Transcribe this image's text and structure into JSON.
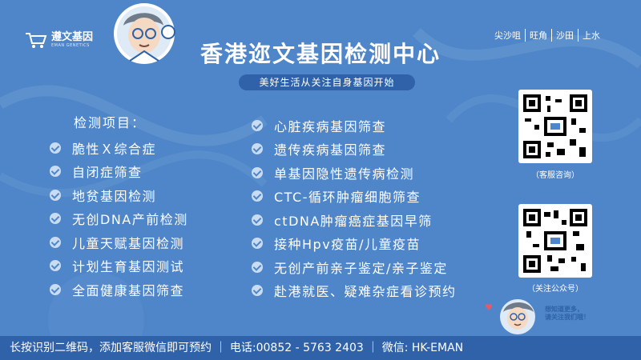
{
  "logo": {
    "name": "遵文基因",
    "sub": "EMAN GENETICS"
  },
  "title": "香港迩文基因检测中心",
  "subtitle": "美好生活从关注自身基因开始",
  "areas": [
    "尖沙咀",
    "旺角",
    "沙田",
    "上水"
  ],
  "left_column": {
    "header": "检测项目：",
    "items": [
      "脆性Ｘ综合症",
      "自闭症筛查",
      "地贫基因检测",
      "无创DNA产前检测",
      "儿童天赋基因检测",
      "计划生育基因测试",
      "全面健康基因筛查"
    ]
  },
  "right_column": {
    "items": [
      "心脏疾病基因筛查",
      "遗传疾病基因筛查",
      "单基因隐性遗传病检测",
      "CTC-循环肿瘤细胞筛查",
      "ctDNA肿瘤癌症基因早筛",
      "接种Hpv疫苗/儿童疫苗",
      "无创产前亲子鉴定/亲子鉴定",
      "赴港就医、疑难杂症看诊预约"
    ]
  },
  "qr": {
    "label_1": "（客服咨询）",
    "label_2": "（关注公众号）"
  },
  "bubble": {
    "line1": "想知道更多，",
    "line2": "请关注我们哦！"
  },
  "footer": "长按识别二维码，添加客服微信即可预约 ｜ 电话:00852 - 5763 2403 ｜ 微信: HK-EMAN",
  "colors": {
    "background": "#4f86c9",
    "band": "#2f62a8",
    "text": "#ffffff",
    "check": "#c9dcf2"
  },
  "icons": [
    "cart-logo-icon",
    "doctor-mascot-icon",
    "check-circle-icon",
    "qr-code-icon",
    "heart-icon"
  ]
}
